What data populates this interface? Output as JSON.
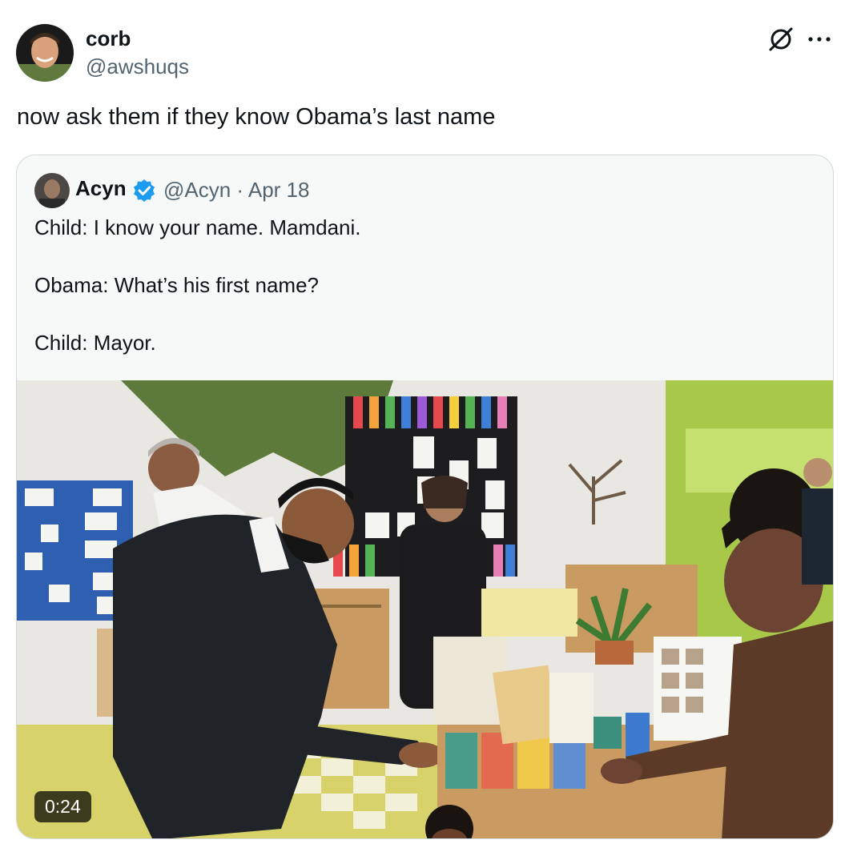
{
  "author": {
    "display_name": "corb",
    "handle": "@awshuqs"
  },
  "tweet": {
    "text": "now ask them if they know Obama’s last name"
  },
  "quoted_tweet": {
    "display_name": "Acyn",
    "meta": "@Acyn · Apr 18",
    "lines": [
      "Child: I know your name. Mamdani.",
      "Obama: What’s his first name?",
      "Child: Mayor."
    ]
  },
  "media": {
    "duration": "0:24"
  },
  "icons": {
    "grok": "grok-icon",
    "more": "more-icon",
    "verified": "verified-badge-icon"
  },
  "colors": {
    "text": "#0f1419",
    "secondary": "#536471",
    "verified": "#1d9bf0",
    "border": "#cfd9de"
  }
}
